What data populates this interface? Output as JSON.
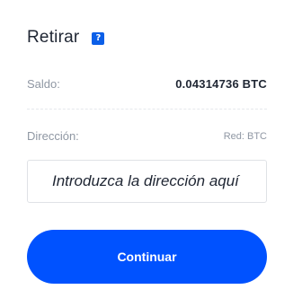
{
  "header": {
    "title": "Retirar",
    "help_icon": "question-icon",
    "help_glyph": "?"
  },
  "balance": {
    "label": "Saldo:",
    "value": "0.04314736 BTC"
  },
  "address": {
    "label": "Dirección:",
    "network": "Red: BTC",
    "placeholder": "Introduzca la dirección aquí",
    "value": ""
  },
  "actions": {
    "continue_label": "Continuar"
  },
  "colors": {
    "accent": "#0052FF",
    "help_icon_bg": "#0B5FE8",
    "text_primary": "#1F2633",
    "text_secondary": "#8F97A3"
  }
}
